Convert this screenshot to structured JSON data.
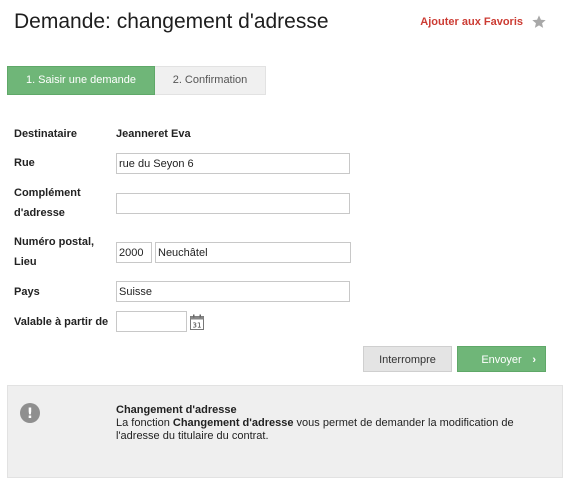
{
  "page": {
    "title": "Demande: changement d'adresse",
    "favorites_label": "Ajouter aux Favoris"
  },
  "steps": [
    {
      "label": "1. Saisir une demande",
      "active": true
    },
    {
      "label": "2. Confirmation",
      "active": false
    }
  ],
  "form": {
    "recipient_label": "Destinataire",
    "recipient_value": "Jeanneret Eva",
    "street_label": "Rue",
    "street_value": "rue du Seyon 6",
    "complement_label_line1": "Complément",
    "complement_label_line2": "d'adresse",
    "complement_value": "",
    "postal_label_line1": "Numéro postal,",
    "postal_label_line2": "Lieu",
    "postal_value": "2000",
    "city_value": "Neuchâtel",
    "country_label": "Pays",
    "country_value": "Suisse",
    "valid_from_label": "Valable à partir de",
    "valid_from_value": "",
    "calendar_day": "31"
  },
  "buttons": {
    "cancel_label": "Interrompre",
    "send_label": "Envoyer",
    "send_chevron": "›"
  },
  "info": {
    "title": "Changement d'adresse",
    "text_prefix": "La fonction ",
    "text_bold": "Changement d'adresse",
    "text_suffix": " vous permet de demander la modification de l'adresse du titulaire du contrat.",
    "icon_glyph": "!"
  },
  "colors": {
    "accent_green": "#6fb678",
    "favorites_red": "#cc3b33"
  }
}
